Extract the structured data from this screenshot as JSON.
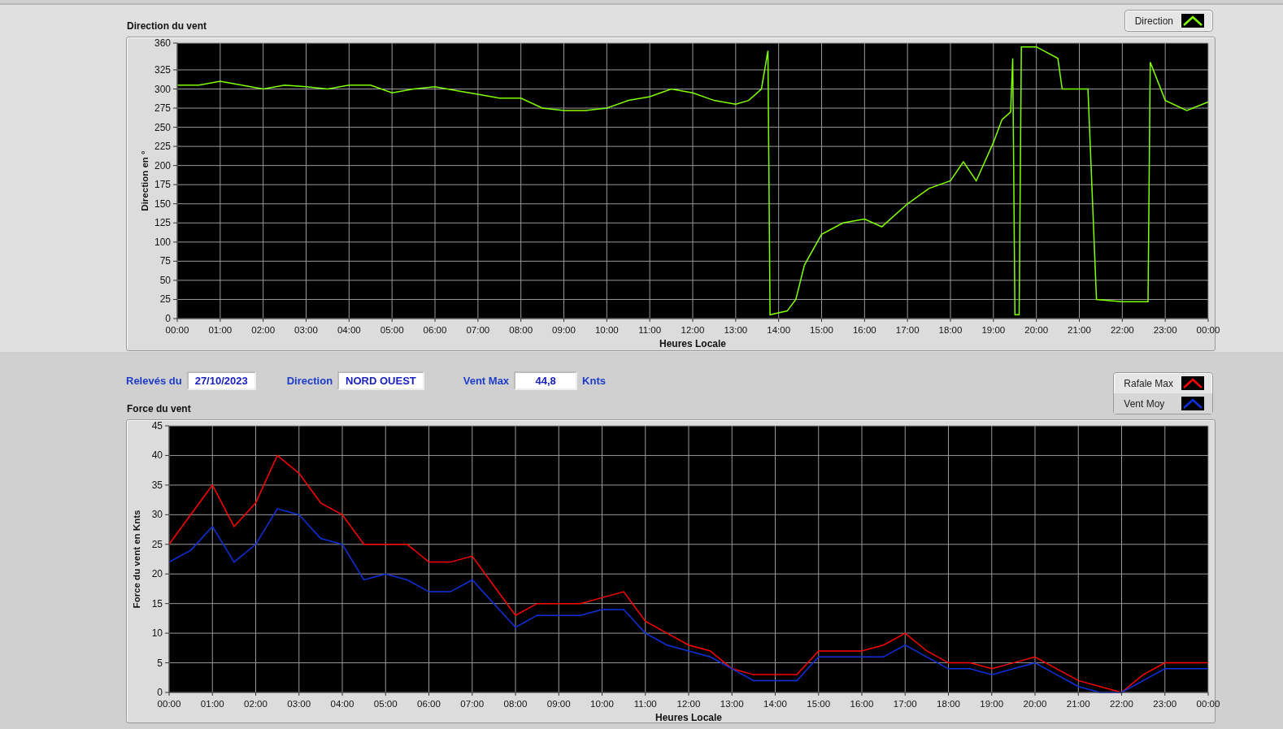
{
  "direction_chart": {
    "title": "Direction du vent",
    "chart_data": {
      "type": "line",
      "grid": true,
      "xlabel": "Heures Locale",
      "ylabel": "Direction en °",
      "xlim": [
        0,
        24
      ],
      "ylim": [
        0,
        360
      ],
      "yticks": [
        0,
        25,
        50,
        75,
        100,
        125,
        150,
        175,
        200,
        225,
        250,
        275,
        300,
        325,
        360
      ],
      "xticks": [
        {
          "value": 0,
          "label": "00:00"
        },
        {
          "value": 1,
          "label": "01:00"
        },
        {
          "value": 2,
          "label": "02:00"
        },
        {
          "value": 3,
          "label": "03:00"
        },
        {
          "value": 4,
          "label": "04:00"
        },
        {
          "value": 5,
          "label": "05:00"
        },
        {
          "value": 6,
          "label": "06:00"
        },
        {
          "value": 7,
          "label": "07:00"
        },
        {
          "value": 8,
          "label": "08:00"
        },
        {
          "value": 9,
          "label": "09:00"
        },
        {
          "value": 10,
          "label": "10:00"
        },
        {
          "value": 11,
          "label": "11:00"
        },
        {
          "value": 12,
          "label": "12:00"
        },
        {
          "value": 13,
          "label": "13:00"
        },
        {
          "value": 14,
          "label": "14:00"
        },
        {
          "value": 15,
          "label": "15:00"
        },
        {
          "value": 16,
          "label": "16:00"
        },
        {
          "value": 17,
          "label": "17:00"
        },
        {
          "value": 18,
          "label": "18:00"
        },
        {
          "value": 19,
          "label": "19:00"
        },
        {
          "value": 20,
          "label": "20:00"
        },
        {
          "value": 21,
          "label": "21:00"
        },
        {
          "value": 22,
          "label": "22:00"
        },
        {
          "value": 23,
          "label": "23:00"
        },
        {
          "value": 24,
          "label": "00:00"
        }
      ],
      "x": [
        0,
        0.5,
        1,
        1.5,
        2,
        2.5,
        3,
        3.5,
        4,
        4.5,
        5,
        5.5,
        6,
        6.5,
        7,
        7.5,
        8,
        8.5,
        9,
        9.5,
        10,
        10.5,
        11,
        11.5,
        12,
        12.5,
        13,
        13.3,
        13.6,
        13.75,
        13.8,
        14.2,
        14.4,
        14.6,
        15,
        15.5,
        16,
        16.4,
        17,
        17.5,
        18,
        18.3,
        18.6,
        19,
        19.2,
        19.4,
        19.45,
        19.5,
        19.6,
        19.65,
        20,
        20.5,
        20.6,
        21.2,
        21.4,
        22,
        22.6,
        22.65,
        23,
        23.5,
        24
      ],
      "series": [
        {
          "name": "Direction",
          "color": "#80ff00",
          "values": [
            305,
            305,
            310,
            305,
            300,
            305,
            303,
            300,
            305,
            305,
            295,
            300,
            303,
            298,
            293,
            288,
            288,
            275,
            272,
            272,
            275,
            285,
            290,
            300,
            295,
            285,
            280,
            285,
            300,
            350,
            5,
            10,
            25,
            70,
            110,
            125,
            130,
            120,
            150,
            170,
            180,
            205,
            180,
            230,
            260,
            270,
            340,
            5,
            5,
            355,
            355,
            340,
            300,
            300,
            25,
            22,
            22,
            335,
            285,
            272,
            283
          ]
        }
      ]
    }
  },
  "readings": [
    {
      "label": "Relevés du",
      "value": "27/10/2023"
    },
    {
      "label": "Direction",
      "value": "NORD OUEST"
    },
    {
      "label": "Vent Max",
      "value": "44,8",
      "unit": "Knts"
    }
  ],
  "force_chart": {
    "title": "Force du vent",
    "chart_data": {
      "type": "line",
      "grid": true,
      "xlabel": "Heures Locale",
      "ylabel": "Force du vent en Knts",
      "xlim": [
        0,
        24
      ],
      "ylim": [
        0,
        45
      ],
      "yticks": [
        0,
        5,
        10,
        15,
        20,
        25,
        30,
        35,
        40,
        45
      ],
      "xticks": [
        {
          "value": 0,
          "label": "00:00"
        },
        {
          "value": 1,
          "label": "01:00"
        },
        {
          "value": 2,
          "label": "02:00"
        },
        {
          "value": 3,
          "label": "03:00"
        },
        {
          "value": 4,
          "label": "04:00"
        },
        {
          "value": 5,
          "label": "05:00"
        },
        {
          "value": 6,
          "label": "06:00"
        },
        {
          "value": 7,
          "label": "07:00"
        },
        {
          "value": 8,
          "label": "08:00"
        },
        {
          "value": 9,
          "label": "09:00"
        },
        {
          "value": 10,
          "label": "10:00"
        },
        {
          "value": 11,
          "label": "11:00"
        },
        {
          "value": 12,
          "label": "12:00"
        },
        {
          "value": 13,
          "label": "13:00"
        },
        {
          "value": 14,
          "label": "14:00"
        },
        {
          "value": 15,
          "label": "15:00"
        },
        {
          "value": 16,
          "label": "16:00"
        },
        {
          "value": 17,
          "label": "17:00"
        },
        {
          "value": 18,
          "label": "18:00"
        },
        {
          "value": 19,
          "label": "19:00"
        },
        {
          "value": 20,
          "label": "20:00"
        },
        {
          "value": 21,
          "label": "21:00"
        },
        {
          "value": 22,
          "label": "22:00"
        },
        {
          "value": 23,
          "label": "23:00"
        },
        {
          "value": 24,
          "label": "00:00"
        }
      ],
      "x": [
        0,
        0.5,
        1,
        1.5,
        2,
        2.5,
        3,
        3.5,
        4,
        4.5,
        5,
        5.5,
        6,
        6.5,
        7,
        7.5,
        8,
        8.5,
        9,
        9.5,
        10,
        10.5,
        11,
        11.5,
        12,
        12.5,
        13,
        13.5,
        14,
        14.5,
        15,
        15.5,
        16,
        16.5,
        17,
        17.5,
        18,
        18.5,
        19,
        19.5,
        20,
        20.5,
        21,
        21.5,
        22,
        22.5,
        23,
        23.5,
        24
      ],
      "series": [
        {
          "name": "Rafale Max",
          "color": "#ff0000",
          "values": [
            25,
            30,
            35,
            28,
            32,
            40,
            37,
            32,
            30,
            25,
            25,
            25,
            22,
            22,
            23,
            18,
            13,
            15,
            15,
            15,
            16,
            17,
            12,
            10,
            8,
            7,
            4,
            3,
            3,
            3,
            7,
            7,
            7,
            8,
            10,
            7,
            5,
            5,
            4,
            5,
            6,
            4,
            2,
            1,
            0,
            3,
            5,
            5,
            5
          ]
        },
        {
          "name": "Vent Moy",
          "color": "#1030e0",
          "values": [
            22,
            24,
            28,
            22,
            25,
            31,
            30,
            26,
            25,
            19,
            20,
            19,
            17,
            17,
            19,
            15,
            11,
            13,
            13,
            13,
            14,
            14,
            10,
            8,
            7,
            6,
            4,
            2,
            2,
            2,
            6,
            6,
            6,
            6,
            8,
            6,
            4,
            4,
            3,
            4,
            5,
            3,
            1,
            0,
            0,
            2,
            4,
            4,
            4
          ]
        }
      ]
    }
  }
}
